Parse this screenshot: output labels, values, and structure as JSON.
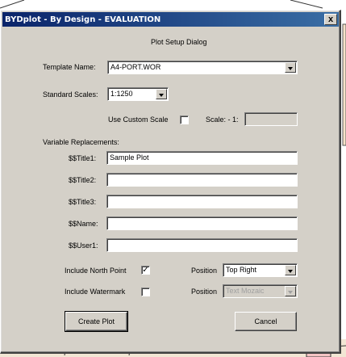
{
  "window": {
    "title": "BYDplot - By Design - EVALUATION",
    "close_glyph": "x"
  },
  "dialog": {
    "heading": "Plot Setup Dialog",
    "template_label": "Template Name:",
    "template_value": "A4-PORT.WOR",
    "scales_label": "Standard Scales:",
    "scales_value": "1:1250",
    "custom_scale_label": "Use Custom Scale",
    "custom_scale_checked": false,
    "scale_label": "Scale: - 1:",
    "scale_value": "",
    "variable_label": "Variable Replacements:",
    "vars": [
      {
        "label": "$$Title1:",
        "value": "Sample Plot"
      },
      {
        "label": "$$Title2:",
        "value": ""
      },
      {
        "label": "$$Title3:",
        "value": ""
      },
      {
        "label": "$$Name:",
        "value": ""
      },
      {
        "label": "$$User1:",
        "value": ""
      }
    ],
    "north_label": "Include North Point",
    "north_checked": true,
    "north_mark": "✓",
    "north_position_label": "Position",
    "north_position_value": "Top Right",
    "watermark_label": "Include Watermark",
    "watermark_checked": false,
    "watermark_position_label": "Position",
    "watermark_position_value": "Text Mozaic",
    "create_button": "Create Plot",
    "cancel_button": "Cancel"
  },
  "colors": {
    "title_start": "#0a246a",
    "title_end": "#3a6ea5",
    "face": "#d4d0c8",
    "map_fill": "#f4c4c4",
    "map_line": "#2a2a2a"
  }
}
